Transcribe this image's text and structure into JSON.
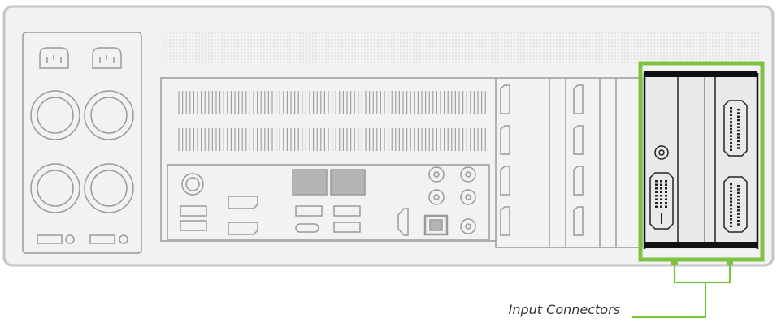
{
  "diagram": {
    "title": "",
    "callout": {
      "label": "Input Connectors",
      "highlight_color": "#7dc242"
    },
    "colors": {
      "chassis_fill": "#f2f2f2",
      "chassis_stroke": "#c4c4c4",
      "outline": "#9a9a9a",
      "card_fill": "#e9e9e9",
      "card_dark": "#111111",
      "port_fill": "#b5b5b5"
    },
    "icons": [
      "power-inlet-icon",
      "dvi-connector-icon",
      "dsub-connector-icon",
      "displayport-icon",
      "hdmi-port-icon",
      "usb-port-icon",
      "ethernet-port-icon",
      "audio-jack-icon"
    ]
  }
}
